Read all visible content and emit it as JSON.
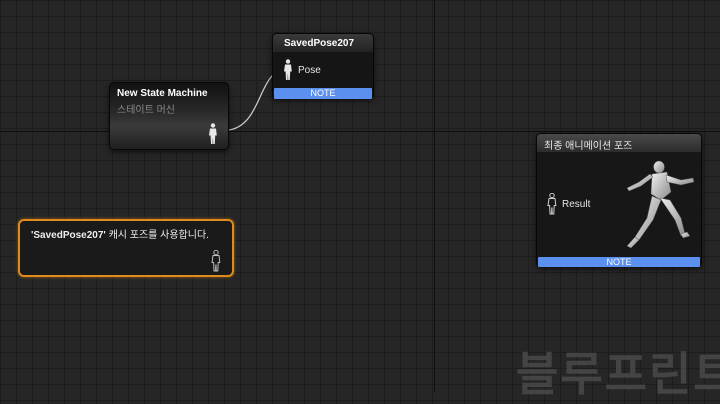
{
  "state_machine_node": {
    "title": "New State Machine",
    "subtitle": "스테이트 머신"
  },
  "saved_pose_node": {
    "title": "SavedPose207",
    "pin_label": "Pose",
    "note_label": "NOTE"
  },
  "comment_node": {
    "bold_text": "'SavedPose207'",
    "text": " 캐시 포즈를 사용합니다."
  },
  "final_pose_node": {
    "title": "최종 애니메이션 포즈",
    "pin_label": "Result",
    "note_label": "NOTE"
  },
  "watermark": {
    "text": "블루프린트"
  },
  "colors": {
    "background": "#262626",
    "note_bar": "#5b8ff0",
    "comment_border": "#e08a1c",
    "wire": "#cfcfcf"
  }
}
